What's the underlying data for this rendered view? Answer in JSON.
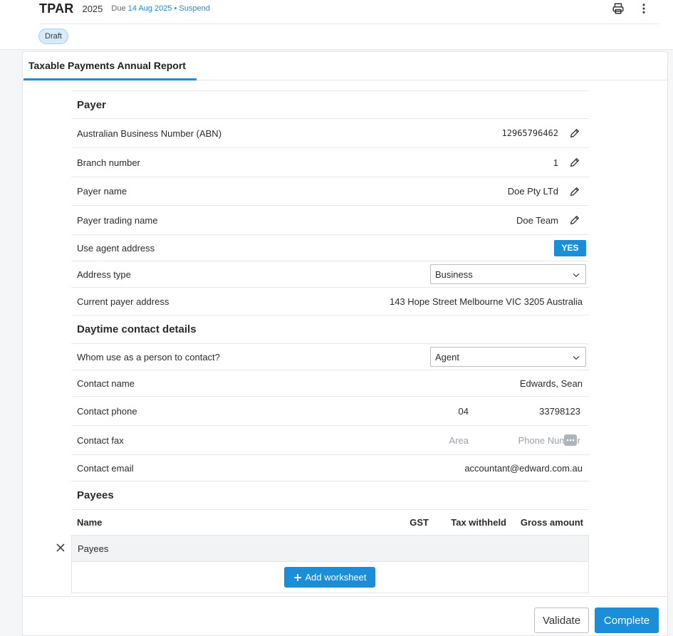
{
  "header": {
    "form_code": "TPAR",
    "year": "2025",
    "due_prefix": "Due",
    "due_date": "14 Aug 2025",
    "separator": "•",
    "suspend_label": "Suspend",
    "status_badge": "Draft",
    "print_icon": "printer-icon",
    "more_icon": "more-vertical-icon"
  },
  "tabs": [
    {
      "label": "Taxable Payments Annual Report",
      "active": true
    }
  ],
  "payer": {
    "section_title": "Payer",
    "abn_label": "Australian Business Number (ABN)",
    "abn_value": "12965796462",
    "branch_label": "Branch number",
    "branch_value": "1",
    "name_label": "Payer name",
    "name_value": "Doe Pty LTd",
    "trading_label": "Payer trading name",
    "trading_value": "Doe Team",
    "agent_addr_label": "Use agent address",
    "agent_addr_toggle": "YES",
    "addr_type_label": "Address type",
    "addr_type_value": "Business",
    "current_addr_label": "Current payer address",
    "current_addr_value": "143 Hope Street Melbourne VIC 3205 Australia"
  },
  "contact": {
    "section_title": "Daytime contact details",
    "whom_label": "Whom use as a person to contact?",
    "whom_value": "Agent",
    "name_label": "Contact name",
    "name_value": "Edwards, Sean",
    "phone_label": "Contact phone",
    "phone_area": "04",
    "phone_number": "33798123",
    "fax_label": "Contact fax",
    "fax_area_placeholder": "Area",
    "fax_number_placeholder": "Phone Number",
    "email_label": "Contact email",
    "email_value": "accountant@edward.com.au"
  },
  "payees": {
    "section_title": "Payees",
    "columns": [
      "Name",
      "GST",
      "Tax withheld",
      "Gross amount"
    ],
    "group_label": "Payees",
    "add_worksheet_label": "Add worksheet"
  },
  "footer": {
    "validate_label": "Validate",
    "complete_label": "Complete"
  },
  "colors": {
    "accent": "#1a8ed8",
    "badge_bg": "#d7ebf9"
  }
}
